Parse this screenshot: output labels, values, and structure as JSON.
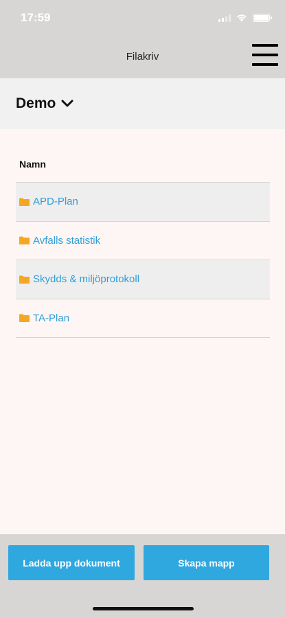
{
  "status": {
    "time": "17:59"
  },
  "nav": {
    "title": "Filakriv"
  },
  "project": {
    "name": "Demo"
  },
  "table": {
    "header": "Namn",
    "rows": [
      {
        "name": "APD-Plan"
      },
      {
        "name": "Avfalls statistik"
      },
      {
        "name": "Skydds & miljöprotokoll"
      },
      {
        "name": "TA-Plan"
      }
    ]
  },
  "footer": {
    "upload_label": "Ladda upp dokument",
    "create_label": "Skapa mapp"
  },
  "colors": {
    "accent": "#2fa7df",
    "link": "#2d9fd8",
    "folder": "#f5a623",
    "bar": "#d8d6d5"
  }
}
